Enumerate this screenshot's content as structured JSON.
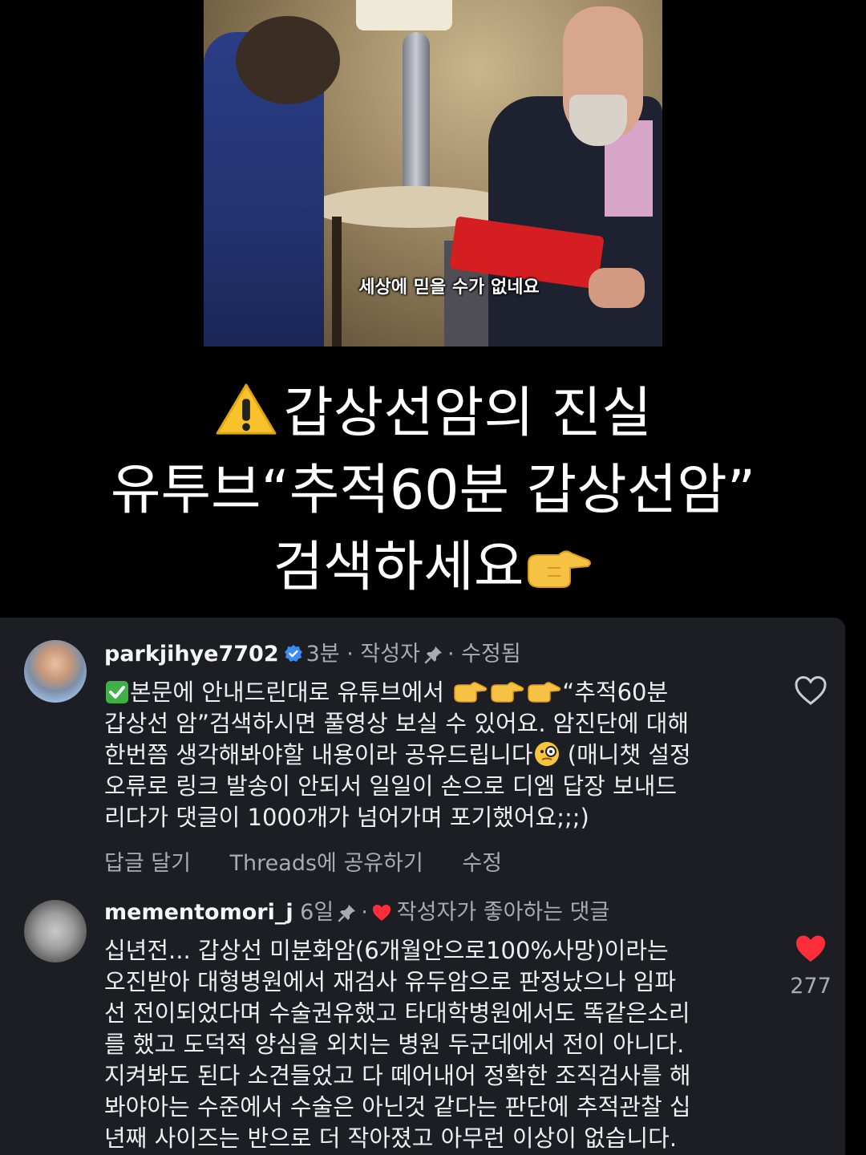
{
  "video": {
    "subtitle": "세상에 믿을 수가 없네요"
  },
  "headline": {
    "line1": "갑상선암의  진실",
    "line2": "유투브“추적60분  갑상선암”",
    "line3": "검색하세요",
    "warn_icon": "warning-emoji",
    "point_icon": "pointing-right-emoji"
  },
  "comments": [
    {
      "username": "parkjihye7702",
      "verified": true,
      "time": "3분",
      "sep1": "·",
      "role": "작성자",
      "sep2": "·",
      "status": "수정됨",
      "check_icon": "check-mark-button-emoji",
      "text_line1_a": "본문에 안내드린대로 유튜브에서 ",
      "text_line1_b": "“추적60분",
      "text_line2": "갑상선 암”검색하시면 풀영상 보실 수 있어요. 암진단에 대해",
      "text_line3_a": "한번쯤 생각해봐야할 내용이라 공유드립니다",
      "text_line3_b": " (매니챗 설정",
      "text_line4": "오류로 링크 발송이 안되서 일일이 손으로 디엠 답장 보내드",
      "text_line5": "리다가 댓글이 1000개가 넘어가며 포기했어요;;;)",
      "actions": {
        "reply": "답글 달기",
        "share": "Threads에 공유하기",
        "edit": "수정"
      },
      "liked": false
    },
    {
      "username": "mementomori_j",
      "time": "6일",
      "sep1": "·",
      "liked_by_author": "작성자가 좋아하는 댓글",
      "text": "십년전... 갑상선 미분화암(6개월안으로100%사망)이라는\n오진받아 대형병원에서 재검사 유두암으로 판정났으나 임파\n선 전이되었다며 수술권유했고 타대학병원에서도 똑같은소리\n를 했고 도덕적 양심을 외치는 병원 두군데에서 전이 아니다.\n지켜봐도 된다 소견들었고 다 떼어내어 정확한 조직검사를 해\n봐야아는 수준에서 수술은 아닌것 같다는 판단에 추적관찰 십\n년째 사이즈는 반으로 더 작아졌고 아무런 이상이 없습니다.",
      "liked": true,
      "like_count": "277"
    }
  ],
  "colors": {
    "background": "#000000",
    "panel": "#1c1e24",
    "muted_text": "#a8abb2",
    "heart_red": "#ff2d3a",
    "verified_blue": "#3b8cf5"
  }
}
